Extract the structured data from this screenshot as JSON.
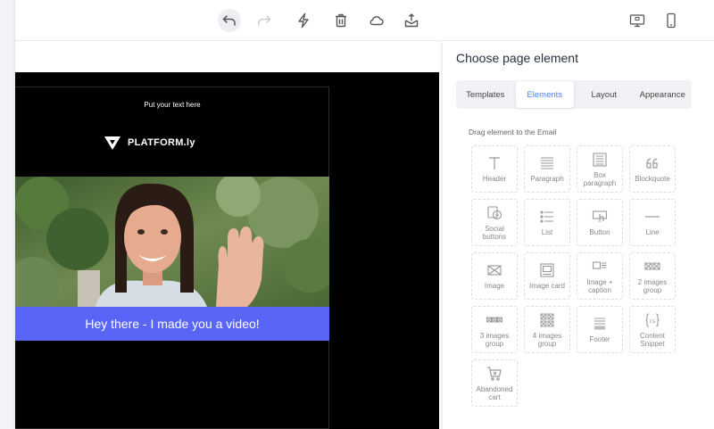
{
  "toolbar": {
    "undo_icon": "undo-icon",
    "redo_icon": "redo-icon",
    "lightning_icon": "lightning-icon",
    "trash_icon": "trash-icon",
    "cloud_icon": "cloud-icon",
    "export_icon": "export-icon",
    "desktop_icon": "desktop-icon",
    "mobile_icon": "mobile-icon"
  },
  "email": {
    "top_text": "Put your text here",
    "logo_text": "PLATFORM.ly",
    "banner_text": "Hey there - I made you a video!",
    "banner_color": "#5865f7"
  },
  "panel": {
    "title": "Choose page element",
    "tabs": [
      {
        "label": "Templates"
      },
      {
        "label": "Elements"
      },
      {
        "label": "Layout"
      },
      {
        "label": "Appearance"
      }
    ],
    "drag_hint": "Drag element to the Email",
    "elements": [
      {
        "label": "Header",
        "icon": "header-icon"
      },
      {
        "label": "Paragraph",
        "icon": "paragraph-icon"
      },
      {
        "label": "Box\nparagraph",
        "icon": "box-paragraph-icon"
      },
      {
        "label": "Blockquote",
        "icon": "quote-icon"
      },
      {
        "label": "Social\nbuttons",
        "icon": "social-icon"
      },
      {
        "label": "List",
        "icon": "list-icon"
      },
      {
        "label": "Button",
        "icon": "button-icon"
      },
      {
        "label": "Line",
        "icon": "line-icon"
      },
      {
        "label": "Image",
        "icon": "image-icon"
      },
      {
        "label": "Image card",
        "icon": "image-card-icon"
      },
      {
        "label": "Image +\ncaption",
        "icon": "image-caption-icon"
      },
      {
        "label": "2 images\ngroup",
        "icon": "two-images-icon"
      },
      {
        "label": "3 images\ngroup",
        "icon": "three-images-icon"
      },
      {
        "label": "4 images\ngroup",
        "icon": "four-images-icon"
      },
      {
        "label": "Footer",
        "icon": "footer-icon"
      },
      {
        "label": "Content\nSnippet",
        "icon": "snippet-icon"
      },
      {
        "label": "Abandoned\ncart",
        "icon": "cart-icon"
      }
    ]
  }
}
